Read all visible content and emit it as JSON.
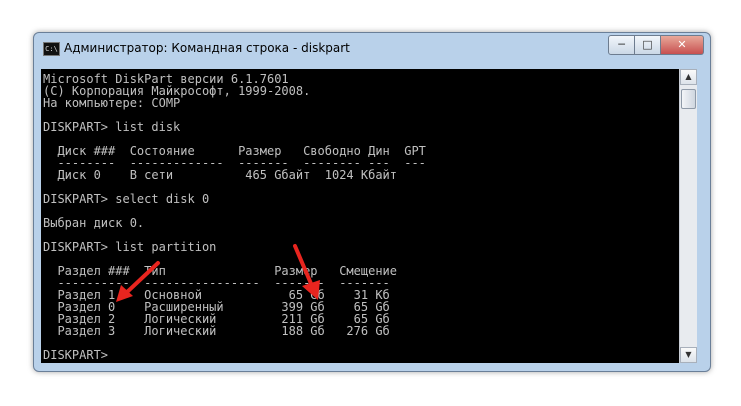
{
  "window": {
    "title": "Администратор: Командная строка - diskpart",
    "icon_label": "C:\\",
    "minimize_glyph": "─",
    "maximize_glyph": "□",
    "close_glyph": "✕"
  },
  "console_lines": [
    "Microsoft DiskPart версии 6.1.7601",
    "(C) Корпорация Майкрософт, 1999-2008.",
    "На компьютере: COMP",
    "",
    "DISKPART> list disk",
    "",
    "  Диск ###  Состояние      Размер   Свободно Дин  GPT",
    "  --------  -------------  -------  -------- ---  ---",
    "  Диск 0    В сети          465 Gбайт  1024 Кбайт",
    "",
    "DISKPART> select disk 0",
    "",
    "Выбран диск 0.",
    "",
    "DISKPART> list partition",
    "",
    "  Раздел ###  Тип               Размер   Смещение",
    "  ----------  ----------------  -------  -------",
    "  Раздел 1    Основной            65 Gб    31 Кб",
    "  Раздел 0    Расширенный        399 Gб    65 Gб",
    "  Раздел 2    Логический         211 Gб    65 Gб",
    "  Раздел 3    Логический         188 Gб   276 Gб",
    "",
    "DISKPART> "
  ],
  "scrollbar": {
    "up_glyph": "▲",
    "down_glyph": "▼"
  },
  "colors": {
    "console_bg": "#000000",
    "console_text": "#c0c0c0",
    "arrow": "#e8251f",
    "frame": "#b9d1ea"
  },
  "icons": [
    "cmd-icon",
    "minimize-icon",
    "maximize-icon",
    "close-icon",
    "red-arrow-icon"
  ]
}
